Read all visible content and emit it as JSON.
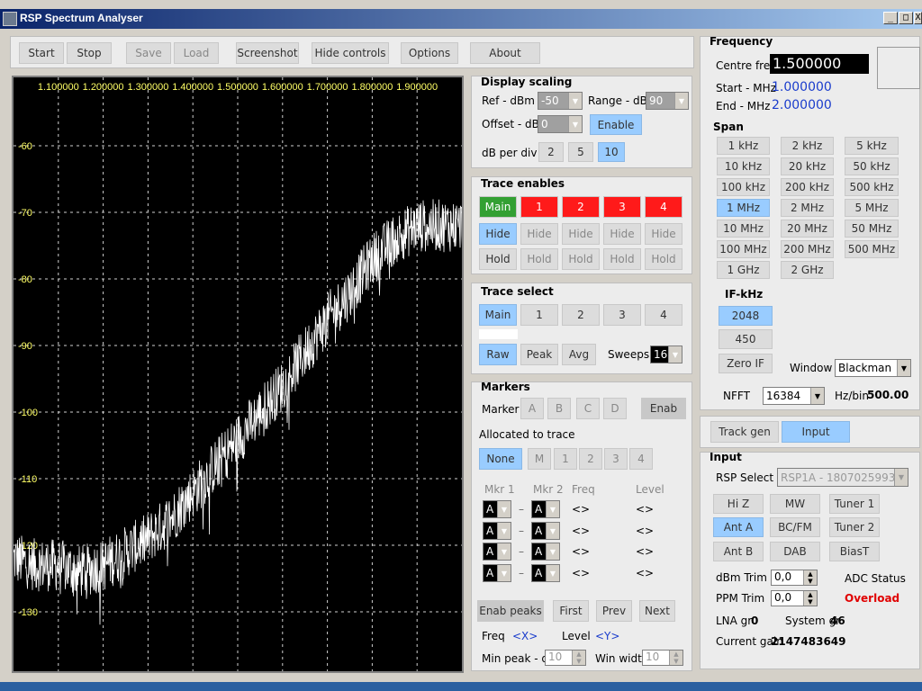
{
  "window": {
    "title": "RSP Spectrum Analyser",
    "min": "_",
    "max": "□",
    "close": "X"
  },
  "toolbar": {
    "start": "Start",
    "stop": "Stop",
    "save": "Save",
    "load": "Load",
    "screenshot": "Screenshot",
    "hide_controls": "Hide controls",
    "options": "Options",
    "about": "About"
  },
  "chart_data": {
    "type": "line",
    "x_ticks": [
      "1.100000",
      "1.200000",
      "1.300000",
      "1.400000",
      "1.500000",
      "1.600000",
      "1.700000",
      "1.800000",
      "1.900000"
    ],
    "y_ticks": [
      "-60",
      "-70",
      "-80",
      "-90",
      "-100",
      "-110",
      "-120",
      "-130"
    ],
    "xlim": [
      1.0,
      2.0
    ],
    "ylim": [
      -140,
      -50
    ],
    "grid": true,
    "series": [
      {
        "x": [
          1.0,
          1.05,
          1.1,
          1.15,
          1.2,
          1.25,
          1.3,
          1.35,
          1.4,
          1.45,
          1.5,
          1.55,
          1.6,
          1.65,
          1.7,
          1.75,
          1.8,
          1.85,
          1.9,
          1.95,
          2.0
        ],
        "values": [
          -122,
          -123,
          -123,
          -124,
          -123,
          -121,
          -119,
          -116,
          -112,
          -108,
          -104,
          -100,
          -96,
          -91,
          -86,
          -82,
          -77,
          -74,
          -72,
          -72,
          -72
        ]
      }
    ]
  },
  "display_scaling": {
    "title": "Display scaling",
    "ref_label": "Ref - dBm",
    "ref_value": "-50",
    "range_label": "Range - dBm",
    "range_value": "90",
    "offset_label": "Offset - dBm",
    "offset_value": "0",
    "enable": "Enable",
    "dbdiv_label": "dB per div",
    "dbdiv": [
      "2",
      "5",
      "10"
    ]
  },
  "trace_enables": {
    "title": "Trace enables",
    "traces": [
      "Main",
      "1",
      "2",
      "3",
      "4"
    ],
    "hide": "Hide",
    "hold": "Hold"
  },
  "trace_select": {
    "title": "Trace select",
    "traces": [
      "Main",
      "1",
      "2",
      "3",
      "4"
    ],
    "raw": "Raw",
    "peak": "Peak",
    "avg": "Avg",
    "sweeps_label": "Sweeps",
    "sweeps_value": "16"
  },
  "markers": {
    "title": "Markers",
    "marker_label": "Marker",
    "markers": [
      "A",
      "B",
      "C",
      "D"
    ],
    "enab": "Enab",
    "allocated": "Allocated to trace",
    "alloc": [
      "None",
      "M",
      "1",
      "2",
      "3",
      "4"
    ],
    "col_mkr1": "Mkr 1",
    "col_mkr2": "Mkr 2",
    "col_freq": "Freq",
    "col_level": "Level",
    "mkr_val": "A",
    "dash": "–",
    "empty_val": "<>",
    "enab_peaks": "Enab peaks",
    "first": "First",
    "prev": "Prev",
    "next": "Next",
    "freq_label": "Freq",
    "freq_val": "<X>",
    "level_label": "Level",
    "level_val": "<Y>",
    "min_peak_label": "Min peak - dB",
    "min_peak_val": "10",
    "win_width_label": "Win width",
    "win_width_val": "10"
  },
  "frequency": {
    "title": "Frequency",
    "centre_label": "Centre freq",
    "centre_value": "1.500000",
    "start_label": "Start - MHz",
    "start_value": "1.000000",
    "end_label": "End - MHz",
    "end_value": "2.000000",
    "span_label": "Span",
    "spans": [
      "1 kHz",
      "2 kHz",
      "5 kHz",
      "10 kHz",
      "20 kHz",
      "50 kHz",
      "100 kHz",
      "200 kHz",
      "500 kHz",
      "1 MHz",
      "2 MHz",
      "5 MHz",
      "10 MHz",
      "20 MHz",
      "50 MHz",
      "100 MHz",
      "200 MHz",
      "500 MHz",
      "1 GHz",
      "2 GHz"
    ],
    "if_label": "IF-kHz",
    "if_opts": [
      "2048",
      "450",
      "Zero IF"
    ],
    "window_label": "Window",
    "window_value": "Blackman",
    "nfft_label": "NFFT",
    "nfft_value": "16384",
    "hzbin_label": "Hz/bin",
    "hzbin_value": "500.00"
  },
  "tabs": {
    "track_gen": "Track gen",
    "input": "Input"
  },
  "input": {
    "title": "Input",
    "rsp_label": "RSP Select",
    "rsp_value": "RSP1A - 1807025993",
    "buttons": [
      "Hi Z",
      "MW",
      "Tuner 1",
      "Ant A",
      "BC/FM",
      "Tuner 2",
      "Ant B",
      "DAB",
      "BiasT"
    ],
    "dbm_trim_label": "dBm Trim",
    "dbm_trim_value": "0,0",
    "ppm_trim_label": "PPM Trim",
    "ppm_trim_value": "0,0",
    "adc_label": "ADC Status",
    "adc_value": "Overload",
    "lna_label": "LNA gr",
    "lna_value": "0",
    "sysgr_label": "System gr",
    "sysgr_value": "46",
    "gain_label": "Current gain",
    "gain_value": "2147483649"
  },
  "colors": {
    "accent": "#99ccff",
    "trace_main": "#33a033",
    "trace_off": "#ff1a1a",
    "overload": "#e00000",
    "freq_text": "#1a3ccc"
  }
}
